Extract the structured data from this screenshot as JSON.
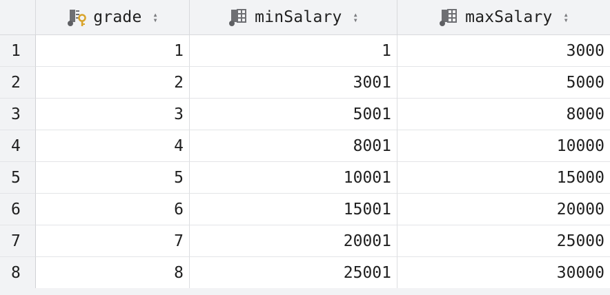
{
  "table": {
    "columns": [
      {
        "name": "grade",
        "icon": "primary-key-column-icon",
        "sort_icon": "sort-arrows-icon"
      },
      {
        "name": "minSalary",
        "icon": "column-icon",
        "sort_icon": "sort-arrows-icon"
      },
      {
        "name": "maxSalary",
        "icon": "column-icon",
        "sort_icon": "sort-arrows-icon"
      }
    ],
    "rows": [
      {
        "num": "1",
        "grade": "1",
        "minSalary": "1",
        "maxSalary": "3000"
      },
      {
        "num": "2",
        "grade": "2",
        "minSalary": "3001",
        "maxSalary": "5000"
      },
      {
        "num": "3",
        "grade": "3",
        "minSalary": "5001",
        "maxSalary": "8000"
      },
      {
        "num": "4",
        "grade": "4",
        "minSalary": "8001",
        "maxSalary": "10000"
      },
      {
        "num": "5",
        "grade": "5",
        "minSalary": "10001",
        "maxSalary": "15000"
      },
      {
        "num": "6",
        "grade": "6",
        "minSalary": "15001",
        "maxSalary": "20000"
      },
      {
        "num": "7",
        "grade": "7",
        "minSalary": "20001",
        "maxSalary": "25000"
      },
      {
        "num": "8",
        "grade": "8",
        "minSalary": "25001",
        "maxSalary": "30000"
      }
    ]
  },
  "colors": {
    "header_bg": "#f2f3f5",
    "grid_line": "#dcdde0",
    "key_icon": "#d9a42b",
    "icon_gray": "#6e6f73"
  }
}
